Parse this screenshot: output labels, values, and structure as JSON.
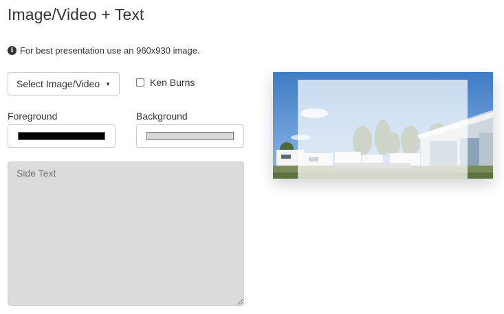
{
  "header": {
    "title": "Image/Video + Text"
  },
  "hint": {
    "icon": "info-icon",
    "text": "For best presentation use an 960x930 image."
  },
  "media": {
    "select_label": "Select Image/Video",
    "caret_icon": "caret-down-icon",
    "ken_burns_label": "Ken Burns",
    "ken_burns_checked": false
  },
  "colors": {
    "foreground_label": "Foreground",
    "foreground_value": "#000000",
    "background_label": "Background",
    "background_value": "#d9d9d9"
  },
  "side_text": {
    "placeholder": "Side Text",
    "value": ""
  },
  "preview": {
    "image": "outdoor-caravan-dealership-photo",
    "overlay_color": "#ffffff"
  }
}
